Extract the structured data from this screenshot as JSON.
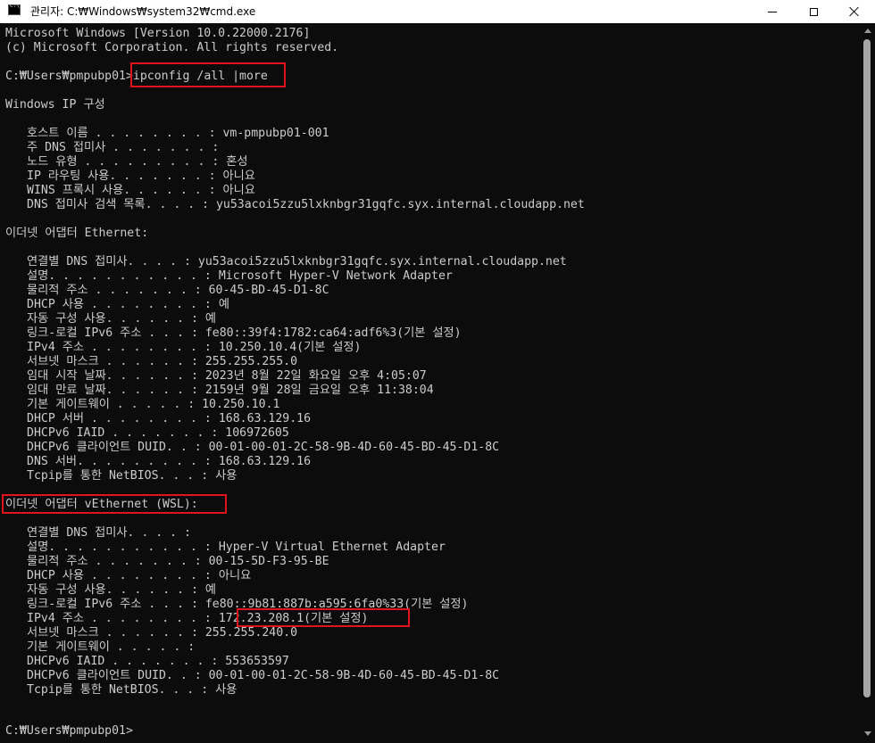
{
  "window": {
    "title": "관리자: C:₩Windows₩system32₩cmd.exe",
    "icon": "cmd-icon"
  },
  "console": {
    "header": [
      "Microsoft Windows [Version 10.0.22000.2176]",
      "(c) Microsoft Corporation. All rights reserved."
    ],
    "prompt1": "C:₩Users₩pmpubp01>",
    "command": "ipconfig /all |more",
    "ip_config_title": "Windows IP 구성",
    "global": [
      "호스트 이름 . . . . . . . . : vm-pmpubp01-001",
      "주 DNS 접미사 . . . . . . . :",
      "노드 유형 . . . . . . . . . : 혼성",
      "IP 라우팅 사용. . . . . . . : 아니요",
      "WINS 프록시 사용. . . . . . : 아니요",
      "DNS 접미사 검색 목록. . . . : yu53acoi5zzu5lxknbgr31gqfc.syx.internal.cloudapp.net"
    ],
    "ethernet_title": "이더넷 어댑터 Ethernet:",
    "ethernet": [
      "연결별 DNS 접미사. . . . : yu53acoi5zzu5lxknbgr31gqfc.syx.internal.cloudapp.net",
      "설명. . . . . . . . . . . : Microsoft Hyper-V Network Adapter",
      "물리적 주소 . . . . . . . : 60-45-BD-45-D1-8C",
      "DHCP 사용 . . . . . . . . : 예",
      "자동 구성 사용. . . . . . : 예",
      "링크-로컬 IPv6 주소 . . . : fe80::39f4:1782:ca64:adf6%3(기본 설정)",
      "IPv4 주소 . . . . . . . . : 10.250.10.4(기본 설정)",
      "서브넷 마스크 . . . . . . : 255.255.255.0",
      "임대 시작 날짜. . . . . . : 2023년 8월 22일 화요일 오후 4:05:07",
      "임대 만료 날짜. . . . . . : 2159년 9월 28일 금요일 오후 11:38:04",
      "기본 게이트웨이 . . . . . : 10.250.10.1",
      "DHCP 서버 . . . . . . . . : 168.63.129.16",
      "DHCPv6 IAID . . . . . . . : 106972605",
      "DHCPv6 클라이언트 DUID. . : 00-01-00-01-2C-58-9B-4D-60-45-BD-45-D1-8C",
      "DNS 서버. . . . . . . . . : 168.63.129.16",
      "Tcpip를 통한 NetBIOS. . . : 사용"
    ],
    "wsl_title": "이더넷 어댑터 vEthernet (WSL):",
    "wsl": [
      "연결별 DNS 접미사. . . . :",
      "설명. . . . . . . . . . . : Hyper-V Virtual Ethernet Adapter",
      "물리적 주소 . . . . . . . : 00-15-5D-F3-95-BE",
      "DHCP 사용 . . . . . . . . : 아니요",
      "자동 구성 사용. . . . . . : 예",
      "링크-로컬 IPv6 주소 . . . : fe80::9b81:887b:a595:6fa0%33(기본 설정)",
      "IPv4 주소 . . . . . . . . : 172.23.208.1(기본 설정)",
      "서브넷 마스크 . . . . . . : 255.255.240.0",
      "기본 게이트웨이 . . . . . :",
      "DHCPv6 IAID . . . . . . . : 553653597",
      "DHCPv6 클라이언트 DUID. . : 00-01-00-01-2C-58-9B-4D-60-45-BD-45-D1-8C",
      "Tcpip를 통한 NetBIOS. . . : 사용"
    ],
    "prompt2": "C:₩Users₩pmpubp01>"
  },
  "colors": {
    "background": "#0c0c0c",
    "text": "#cccccc",
    "highlight": "#e0141a"
  }
}
